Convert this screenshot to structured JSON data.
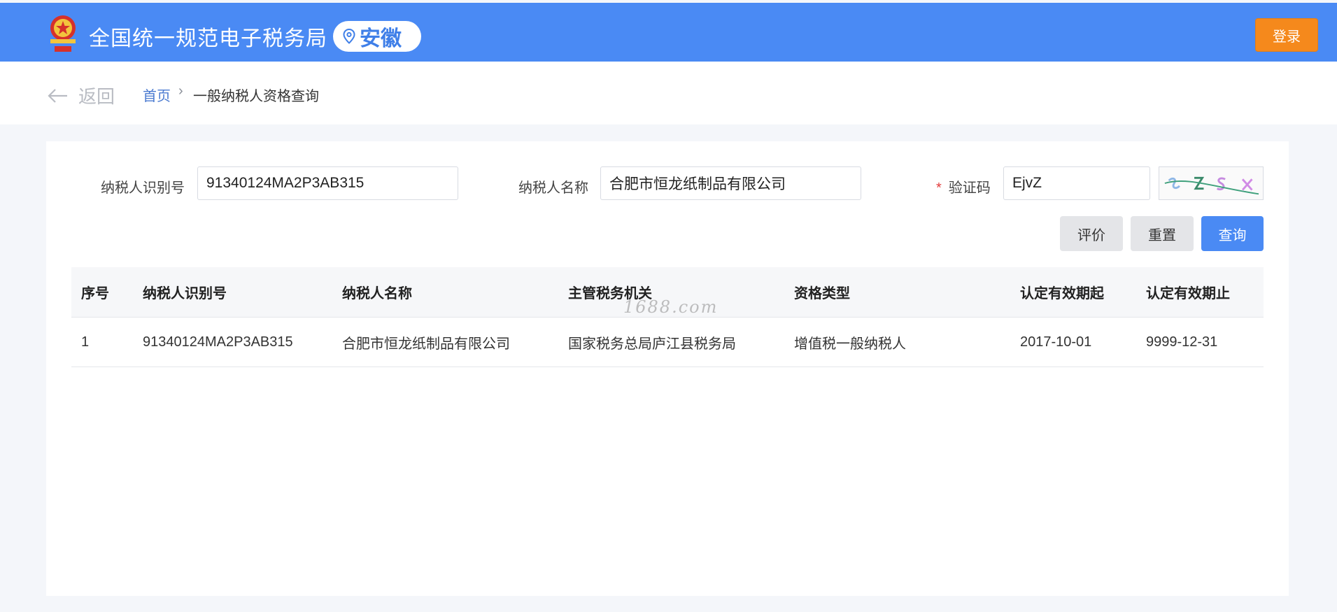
{
  "header": {
    "site_title": "全国统一规范电子税务局",
    "region": "安徽",
    "login_label": "登录",
    "brand_color": "#4a8af4",
    "login_color": "#f5891c"
  },
  "breadcrumb": {
    "back_label": "返回",
    "home": "首页",
    "separator": "›",
    "current": "一般纳税人资格查询"
  },
  "form": {
    "taxpayer_id_label": "纳税人识别号",
    "taxpayer_id_value": "91340124MA2P3AB315",
    "taxpayer_name_label": "纳税人名称",
    "taxpayer_name_value": "合肥市恒龙纸制品有限公司",
    "captcha_label": "验证码",
    "captcha_required_mark": "*",
    "captcha_value": "EjvZ"
  },
  "actions": {
    "evaluate_label": "评价",
    "reset_label": "重置",
    "query_label": "查询"
  },
  "table": {
    "columns": [
      "序号",
      "纳税人识别号",
      "纳税人名称",
      "主管税务机关",
      "资格类型",
      "认定有效期起",
      "认定有效期止"
    ],
    "rows": [
      [
        "1",
        "91340124MA2P3AB315",
        "合肥市恒龙纸制品有限公司",
        "国家税务总局庐江县税务局",
        "增值税一般纳税人",
        "2017-10-01",
        "9999-12-31"
      ]
    ]
  },
  "watermark": "1688.com"
}
